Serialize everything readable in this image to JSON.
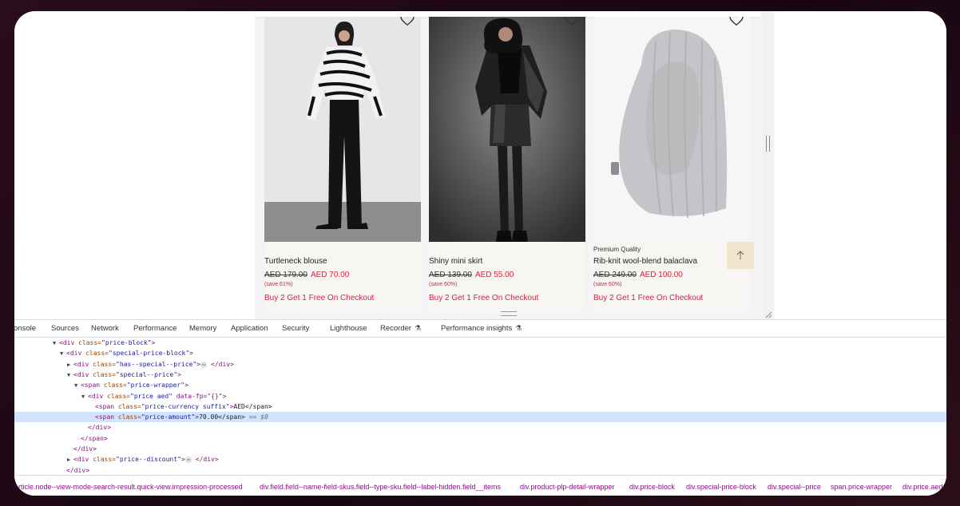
{
  "products": [
    {
      "overline": "",
      "name": "Turtleneck blouse",
      "old_price": "AED 179.00",
      "new_price": "AED 70.00",
      "save": "(save 61%)",
      "promo": "Buy 2 Get 1 Free On Checkout"
    },
    {
      "overline": "",
      "name": "Shiny mini skirt",
      "old_price": "AED 139.00",
      "new_price": "AED 55.00",
      "save": "(save 60%)",
      "promo": "Buy 2 Get 1 Free On Checkout"
    },
    {
      "overline": "Premium Quality",
      "name": "Rib-knit wool-blend balaclava",
      "old_price": "AED 249.00",
      "new_price": "AED 100.00",
      "save": "(save 60%)",
      "promo": "Buy 2 Get 1 Free On Checkout"
    }
  ],
  "icons": {
    "wishlist": "heart-icon",
    "back_to_top": "arrow-up-icon",
    "lab": "flask-icon"
  },
  "colors": {
    "sale_red": "#d0253e",
    "back_to_top_bg": "#efe4cc",
    "selected_node": "#d2e3fc",
    "tag": "#881280",
    "attr_name": "#994500",
    "attr_value": "#1a1aa6"
  },
  "devtools": {
    "tabs": [
      "onsole",
      "Sources",
      "Network",
      "Performance",
      "Memory",
      "Application",
      "Security",
      "Lighthouse",
      "Recorder",
      "Performance insights"
    ],
    "tree": [
      {
        "open": "▼",
        "tag": "<div ",
        "attr": "class=",
        "val": "\"price-block\"",
        "close": ">",
        "text": ""
      },
      {
        "open": "▼",
        "tag": "<div ",
        "attr": "class=",
        "val": "\"special-price-block\"",
        "close": ">",
        "text": ""
      },
      {
        "open": "▶",
        "tag": "<div ",
        "attr": "class=",
        "val": "\"has--special--price\"",
        "close": ">",
        "text": " </div>"
      },
      {
        "open": "▼",
        "tag": "<div ",
        "attr": "class=",
        "val": "\"special--price\"",
        "close": ">",
        "text": ""
      },
      {
        "open": "▼",
        "tag": "<span ",
        "attr": "class=",
        "val": "\"price-wrapper\"",
        "close": ">",
        "text": ""
      },
      {
        "open": "▼",
        "tag": "<div ",
        "attr": "class=",
        "val": "\"price aed\"",
        "close": " data-fp=\"{}\">",
        "text": ""
      },
      {
        "open": "",
        "tag": "<span ",
        "attr": "class=",
        "val": "\"price-currency suffix\"",
        "close": ">",
        "text": "AED</span>"
      },
      {
        "open": "",
        "tag": "<span ",
        "attr": "class=",
        "val": "\"price-amount\"",
        "close": ">",
        "text": "70.00</span>"
      },
      {
        "open": "",
        "tag": "</div>",
        "attr": "",
        "val": "",
        "close": "",
        "text": ""
      },
      {
        "open": "",
        "tag": "</span>",
        "attr": "",
        "val": "",
        "close": "",
        "text": ""
      },
      {
        "open": "",
        "tag": "</div>",
        "attr": "",
        "val": "",
        "close": "",
        "text": ""
      },
      {
        "open": "▶",
        "tag": "<div ",
        "attr": "class=",
        "val": "\"price--discount\"",
        "close": ">",
        "text": " </div>"
      },
      {
        "open": "",
        "tag": "</div>",
        "attr": "",
        "val": "",
        "close": "",
        "text": ""
      }
    ],
    "selected_suffix": " == $0",
    "breadcrumbs": [
      "article.node--view-mode-search-result.quick-view.impression-processed",
      "div.field.field--name-field-skus.field--type-sku.field--label-hidden.field__items",
      "div.product-plp-detail-wrapper",
      "div.price-block",
      "div.special-price-block",
      "div.special--price",
      "span.price-wrapper",
      "div.price.aed"
    ]
  }
}
